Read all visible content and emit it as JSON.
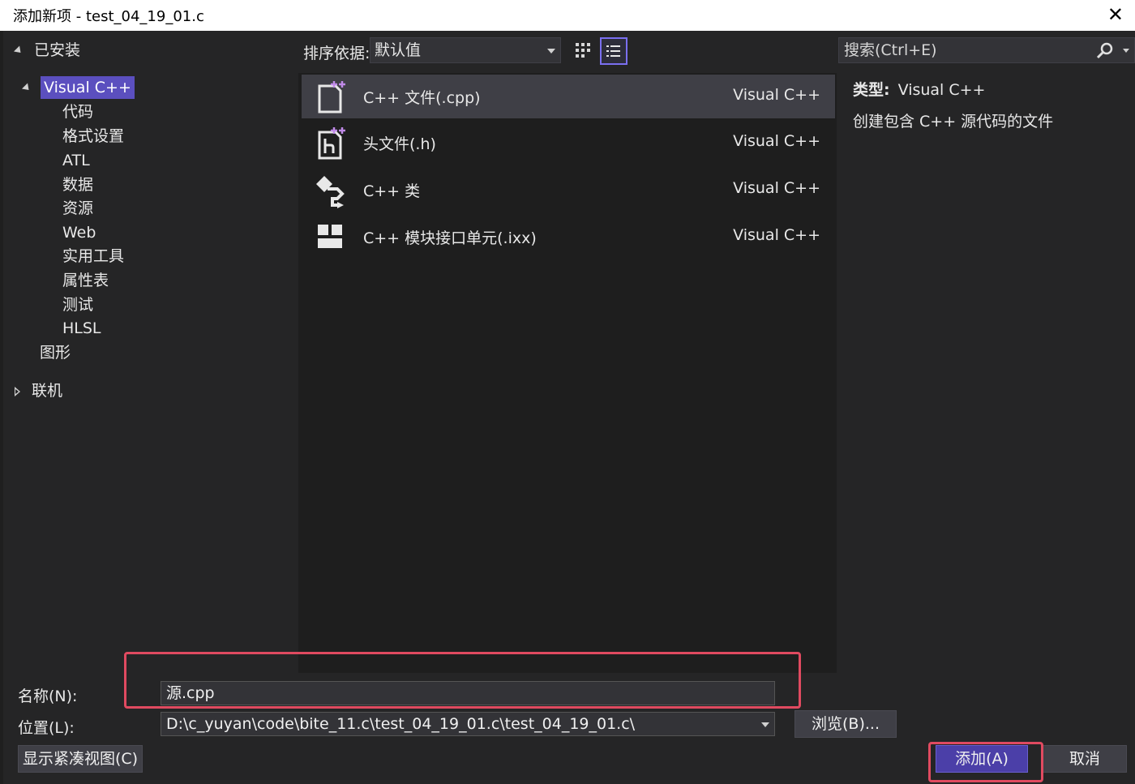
{
  "window": {
    "title": "添加新项 - test_04_19_01.c",
    "close_glyph": "✕"
  },
  "tree": {
    "installed_label": "已安装",
    "selected_label": "Visual C++",
    "children": [
      "代码",
      "格式设置",
      "ATL",
      "数据",
      "资源",
      "Web",
      "实用工具",
      "属性表",
      "测试",
      "HLSL"
    ],
    "graphics_label": "图形",
    "online_label": "联机"
  },
  "sort": {
    "label": "排序依据:",
    "value": "默认值"
  },
  "templates": [
    {
      "name": "C++ 文件(.cpp)",
      "lang": "Visual C++",
      "icon": "cpp-file-icon",
      "selected": true
    },
    {
      "name": "头文件(.h)",
      "lang": "Visual C++",
      "icon": "header-file-icon",
      "selected": false
    },
    {
      "name": "C++ 类",
      "lang": "Visual C++",
      "icon": "cpp-class-icon",
      "selected": false
    },
    {
      "name": "C++ 模块接口单元(.ixx)",
      "lang": "Visual C++",
      "icon": "module-unit-icon",
      "selected": false
    }
  ],
  "search": {
    "placeholder": "搜索(Ctrl+E)"
  },
  "details": {
    "type_label": "类型:",
    "type_value": "Visual C++",
    "description": "创建包含 C++ 源代码的文件"
  },
  "form": {
    "name_label": "名称(N):",
    "name_value": "源.cpp",
    "location_label": "位置(L):",
    "location_value": "D:\\c_yuyan\\code\\bite_11.c\\test_04_19_01.c\\test_04_19_01.c\\",
    "browse_label": "浏览(B)...",
    "compact_view_label": "显示紧凑视图(C)",
    "add_label": "添加(A)",
    "cancel_label": "取消"
  },
  "colors": {
    "accent": "#5b4fbf",
    "highlight_box": "#e04a60",
    "background": "#252526"
  }
}
